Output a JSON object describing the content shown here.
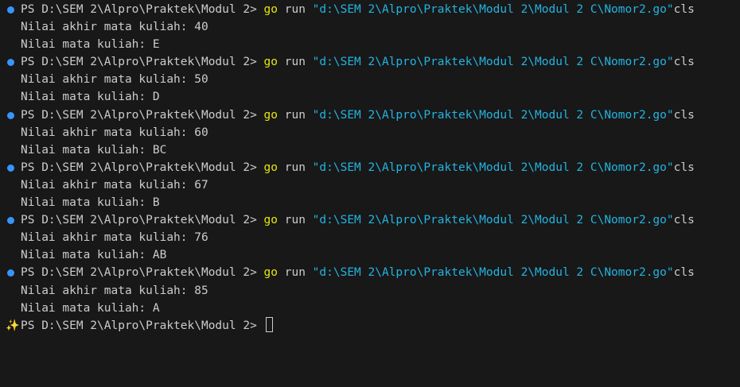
{
  "colors": {
    "background": "#181818",
    "foreground": "#cccccc",
    "command_go": "#e5e510",
    "string": "#23b3e0",
    "prompt_dot": "#3794ff"
  },
  "icons": {
    "prompt_marker": "circle-dot",
    "last_prompt_marker": "sparkle"
  },
  "terminal": {
    "runs": [
      {
        "prompt": "PS D:\\SEM 2\\Alpro\\Praktek\\Modul 2> ",
        "cmd": "go",
        "args": " run ",
        "path": "\"d:\\SEM 2\\Alpro\\Praktek\\Modul 2\\Modul 2 C\\Nomor2.go\"",
        "suffix": "cls",
        "output1": "Nilai akhir mata kuliah: 40",
        "output2": "Nilai mata kuliah: E"
      },
      {
        "prompt": "PS D:\\SEM 2\\Alpro\\Praktek\\Modul 2> ",
        "cmd": "go",
        "args": " run ",
        "path": "\"d:\\SEM 2\\Alpro\\Praktek\\Modul 2\\Modul 2 C\\Nomor2.go\"",
        "suffix": "cls",
        "output1": "Nilai akhir mata kuliah: 50",
        "output2": "Nilai mata kuliah: D"
      },
      {
        "prompt": "PS D:\\SEM 2\\Alpro\\Praktek\\Modul 2> ",
        "cmd": "go",
        "args": " run ",
        "path": "\"d:\\SEM 2\\Alpro\\Praktek\\Modul 2\\Modul 2 C\\Nomor2.go\"",
        "suffix": "cls",
        "output1": "Nilai akhir mata kuliah: 60",
        "output2": "Nilai mata kuliah: BC"
      },
      {
        "prompt": "PS D:\\SEM 2\\Alpro\\Praktek\\Modul 2> ",
        "cmd": "go",
        "args": " run ",
        "path": "\"d:\\SEM 2\\Alpro\\Praktek\\Modul 2\\Modul 2 C\\Nomor2.go\"",
        "suffix": "cls",
        "output1": "Nilai akhir mata kuliah: 67",
        "output2": "Nilai mata kuliah: B"
      },
      {
        "prompt": "PS D:\\SEM 2\\Alpro\\Praktek\\Modul 2> ",
        "cmd": "go",
        "args": " run ",
        "path": "\"d:\\SEM 2\\Alpro\\Praktek\\Modul 2\\Modul 2 C\\Nomor2.go\"",
        "suffix": "cls",
        "output1": "Nilai akhir mata kuliah: 76",
        "output2": "Nilai mata kuliah: AB"
      },
      {
        "prompt": "PS D:\\SEM 2\\Alpro\\Praktek\\Modul 2> ",
        "cmd": "go",
        "args": " run ",
        "path": "\"d:\\SEM 2\\Alpro\\Praktek\\Modul 2\\Modul 2 C\\Nomor2.go\"",
        "suffix": "cls",
        "output1": "Nilai akhir mata kuliah: 85",
        "output2": "Nilai mata kuliah: A"
      }
    ],
    "final_prompt": "PS D:\\SEM 2\\Alpro\\Praktek\\Modul 2> "
  }
}
